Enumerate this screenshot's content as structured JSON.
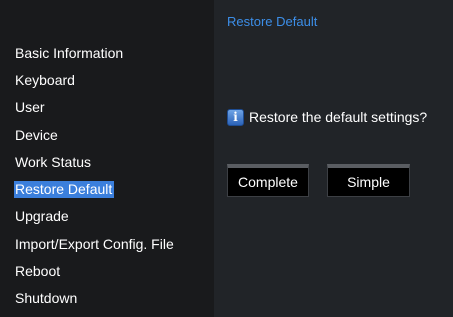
{
  "sidebar": {
    "items": [
      {
        "label": "Basic Information"
      },
      {
        "label": "Keyboard"
      },
      {
        "label": "User"
      },
      {
        "label": "Device"
      },
      {
        "label": "Work Status"
      },
      {
        "label": "Restore Default",
        "active": true
      },
      {
        "label": "Upgrade"
      },
      {
        "label": "Import/Export Config. File"
      },
      {
        "label": "Reboot"
      },
      {
        "label": "Shutdown"
      }
    ]
  },
  "main": {
    "title": "Restore Default",
    "prompt": "Restore the default settings?",
    "prompt_icon": "info-icon",
    "complete_label": "Complete",
    "simple_label": "Simple"
  },
  "colors": {
    "sidebar_bg": "#191a1c",
    "main_bg": "#212428",
    "accent": "#3b7fdc",
    "title": "#3c8ee8"
  }
}
